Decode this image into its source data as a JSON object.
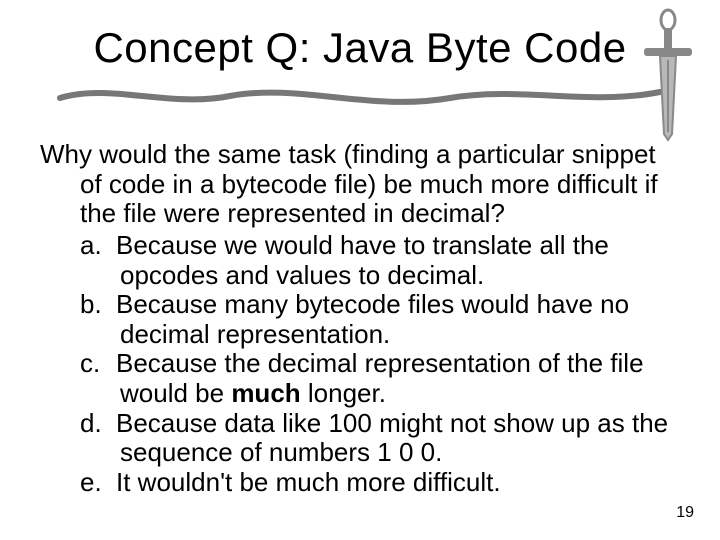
{
  "title": "Concept Q: Java Byte Code",
  "question": "Why would the same task (finding a particular snippet of code in a bytecode file) be much more difficult if the file were represented in decimal?",
  "options": {
    "a": {
      "label": "a.",
      "text": "Because we would have to translate all the opcodes and values to decimal."
    },
    "b": {
      "label": "b.",
      "text": "Because many bytecode files would have no decimal representation."
    },
    "c": {
      "label": "c.",
      "pre": "Because the decimal representation of the file would be ",
      "bold": "much",
      "post": " longer."
    },
    "d": {
      "label": "d.",
      "text": "Because data like 100 might not show up as the sequence of numbers 1 0 0."
    },
    "e": {
      "label": "e.",
      "text": "It wouldn't be much more difficult."
    }
  },
  "page_number": "19"
}
